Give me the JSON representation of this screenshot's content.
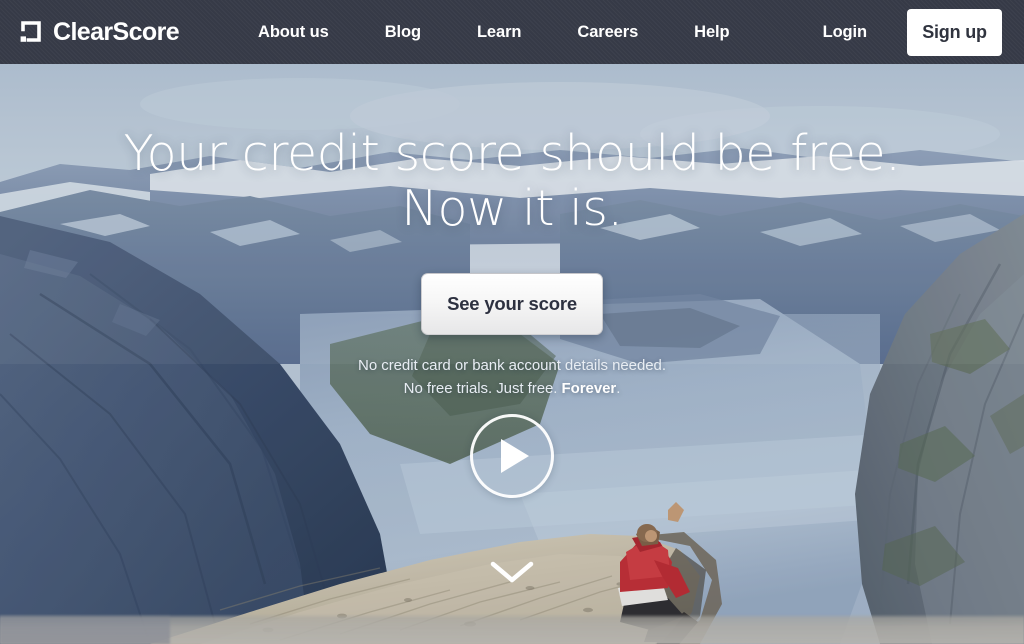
{
  "header": {
    "brand": {
      "name": "ClearScore",
      "logo_icon": "clearscore-square-mark-icon"
    },
    "nav_items": [
      {
        "label": "About us"
      },
      {
        "label": "Blog"
      },
      {
        "label": "Learn"
      },
      {
        "label": "Careers"
      },
      {
        "label": "Help"
      }
    ],
    "login_label": "Login",
    "signup_label": "Sign up",
    "background_color": "#383C49",
    "text_color": "#FFFFFF",
    "signup_bg_color": "#FFFFFF",
    "signup_text_color": "#30343F"
  },
  "hero": {
    "headline_line1": "Your credit score should be free.",
    "headline_line2": "Now it is.",
    "cta_label": "See your score",
    "subtext_line1": "No credit card or bank account details needed.",
    "subtext_line2_a": "No free trials. Just free. ",
    "subtext_line2_bold": "Forever",
    "subtext_line2_b": ".",
    "play_icon": "play-circle-icon",
    "scroll_icon": "chevron-down-icon",
    "image_description": "Person in a red jacket sitting on a rocky cliff edge overlooking a blue fjord surrounded by snow-capped mountains",
    "colors": {
      "sky": "#B9C7D5",
      "far_mountain": "#7D90AB",
      "snow": "#D8E0E8",
      "water": "#9FB2C8",
      "left_cliff": "#3C4E6B",
      "right_cliff": "#6F7A85",
      "rock_ledge": "#C3BAA6",
      "jacket": "#BE2B31"
    }
  }
}
